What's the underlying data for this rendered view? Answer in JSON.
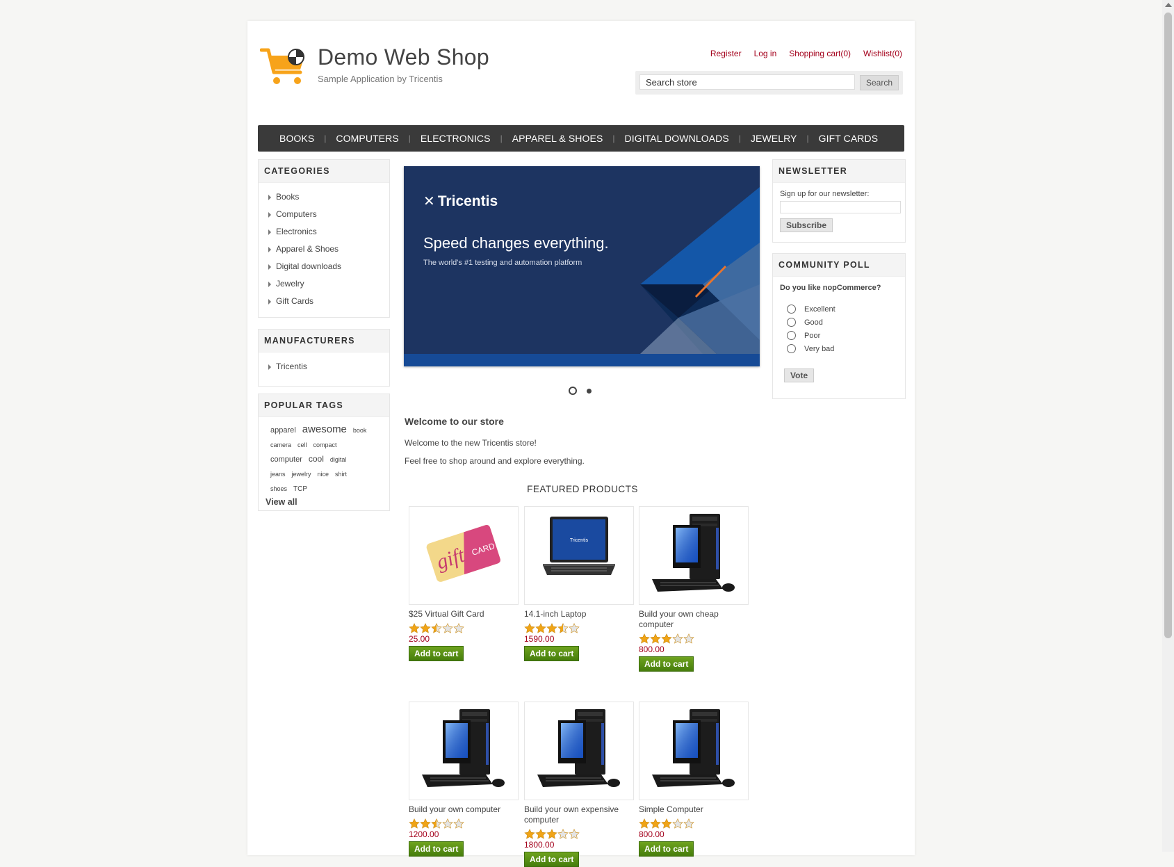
{
  "header": {
    "title": "Demo Web Shop",
    "subtitle": "Sample Application by Tricentis",
    "links": {
      "register": "Register",
      "login": "Log in",
      "cart": "Shopping cart(0)",
      "wishlist": "Wishlist(0)"
    },
    "search_value": "Search store",
    "search_button": "Search"
  },
  "menu": [
    "BOOKS",
    "COMPUTERS",
    "ELECTRONICS",
    "APPAREL & SHOES",
    "DIGITAL DOWNLOADS",
    "JEWELRY",
    "GIFT CARDS"
  ],
  "categories": {
    "title": "CATEGORIES",
    "items": [
      "Books",
      "Computers",
      "Electronics",
      "Apparel & Shoes",
      "Digital downloads",
      "Jewelry",
      "Gift Cards"
    ]
  },
  "manufacturers": {
    "title": "MANUFACTURERS",
    "items": [
      "Tricentis"
    ]
  },
  "tags": {
    "title": "POPULAR TAGS",
    "items": [
      "apparel",
      "awesome",
      "book",
      "camera",
      "cell",
      "compact",
      "computer",
      "cool",
      "digital",
      "jeans",
      "jewelry",
      "nice",
      "shirt",
      "shoes",
      "TCP"
    ],
    "view_all": "View all"
  },
  "slider": {
    "brand": "Tricentis",
    "headline": "Speed changes everything.",
    "tagline": "The world's #1 testing and automation platform"
  },
  "welcome": {
    "title": "Welcome to our store",
    "line1": "Welcome to the new Tricentis store!",
    "line2": "Feel free to shop around and explore everything."
  },
  "featured_title": "FEATURED PRODUCTS",
  "products": [
    {
      "title": "$25 Virtual Gift Card",
      "price": "25.00",
      "rating": 2.5,
      "button": "Add to cart",
      "img": "gift-card"
    },
    {
      "title": "14.1-inch Laptop",
      "price": "1590.00",
      "rating": 3.5,
      "button": "Add to cart",
      "img": "laptop"
    },
    {
      "title": "Build your own cheap computer",
      "price": "800.00",
      "rating": 3,
      "button": "Add to cart",
      "img": "desktop"
    },
    {
      "title": "Build your own computer",
      "price": "1200.00",
      "rating": 2.5,
      "button": "Add to cart",
      "img": "desktop"
    },
    {
      "title": "Build your own expensive computer",
      "price": "1800.00",
      "rating": 3,
      "button": "Add to cart",
      "img": "desktop"
    },
    {
      "title": "Simple Computer",
      "price": "800.00",
      "rating": 3,
      "button": "Add to cart",
      "img": "desktop"
    }
  ],
  "newsletter": {
    "title": "NEWSLETTER",
    "label": "Sign up for our newsletter:",
    "button": "Subscribe"
  },
  "poll": {
    "title": "COMMUNITY POLL",
    "question": "Do you like nopCommerce?",
    "options": [
      "Excellent",
      "Good",
      "Poor",
      "Very bad"
    ],
    "button": "Vote"
  },
  "colors": {
    "link_red": "#a3001b",
    "menu_bg": "#3a3a3a",
    "add_green": "#4e8e0f",
    "banner_blue": "#1d3461"
  }
}
